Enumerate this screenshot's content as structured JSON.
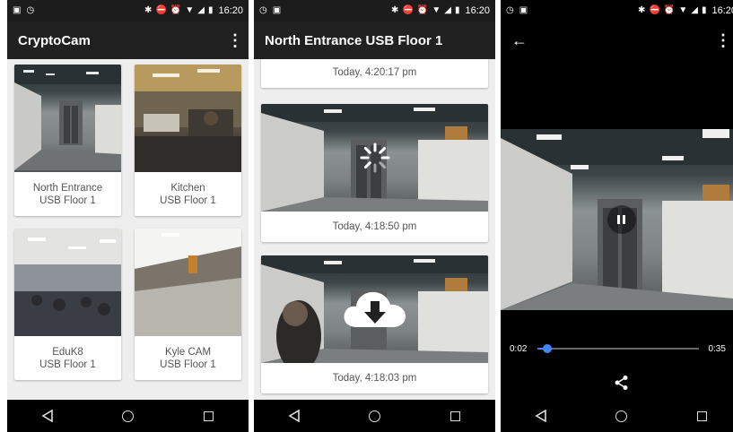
{
  "status_bar": {
    "time": "16:20"
  },
  "screen_list": {
    "app_title": "CryptoCam",
    "menu_icon": "more-vert-icon",
    "cameras": [
      {
        "name": "North Entrance",
        "location": "USB Floor 1",
        "scene": "corridor"
      },
      {
        "name": "Kitchen",
        "location": "USB Floor 1",
        "scene": "kitchen"
      },
      {
        "name": "EduK8",
        "location": "USB Floor 1",
        "scene": "office"
      },
      {
        "name": "Kyle CAM",
        "location": "USB Floor 1",
        "scene": "hall"
      }
    ]
  },
  "screen_recordings": {
    "title": "North Entrance USB Floor 1",
    "recordings": [
      {
        "time": "Today, 4:20:17 pm",
        "state": "partial"
      },
      {
        "time": "Today, 4:18:50 pm",
        "state": "loading"
      },
      {
        "time": "Today, 4:18:03 pm",
        "state": "download"
      }
    ]
  },
  "screen_player": {
    "current_time": "0:02",
    "duration": "0:35",
    "progress": 0.06,
    "accent_color": "#4285f4"
  }
}
